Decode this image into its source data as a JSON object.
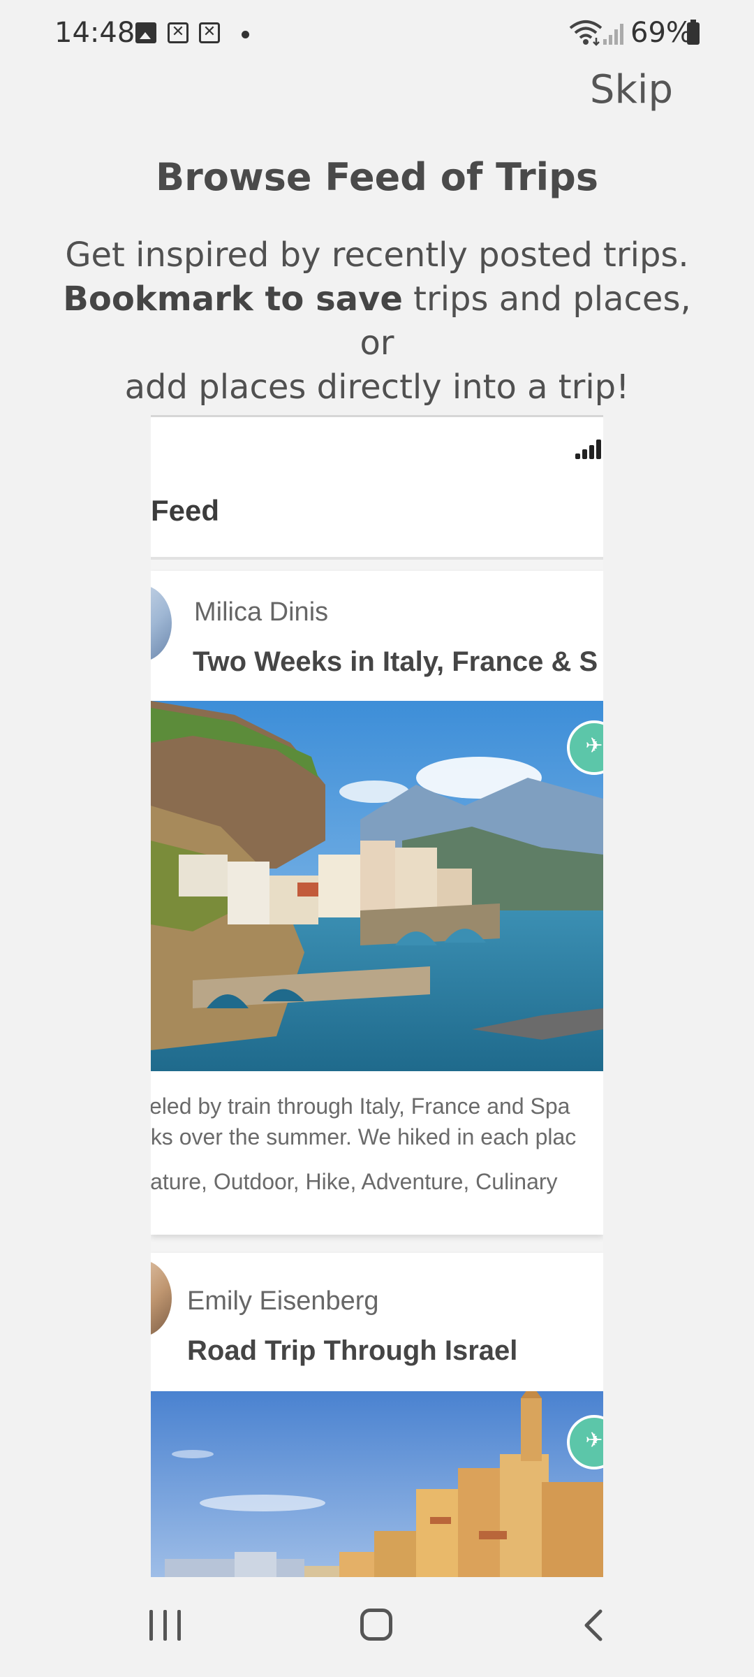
{
  "status_bar": {
    "time": "14:48",
    "battery": "69%",
    "icons": [
      "gallery-icon",
      "xbox-icon",
      "xbox-icon",
      "dot-icon",
      "wifi-icon",
      "signal-icon",
      "battery-icon"
    ]
  },
  "onboarding": {
    "skip_label": "Skip",
    "title": "Browse Feed of Trips",
    "subtitle_line1": "Get inspired by recently posted trips.",
    "subtitle_bold": "Bookmark to save",
    "subtitle_line2_rest": " trips and places, or",
    "subtitle_line3": "add places directly into a trip!"
  },
  "mockup": {
    "header_title": "Feed",
    "posts": [
      {
        "author": "Milica Dinis",
        "title": "Two Weeks in Italy, France & S",
        "description_line1": "veled by train through Italy, France and Spa",
        "description_line2": "eks over the summer. We hiked in each plac",
        "tags": "lature, Outdoor, Hike, Adventure, Culinary"
      },
      {
        "author": "Emily Eisenberg",
        "title": "Road Trip Through Israel"
      }
    ]
  },
  "nav": {
    "icons": [
      "recents-icon",
      "home-icon",
      "back-icon"
    ]
  },
  "colors": {
    "background": "#f2f2f2",
    "accent_badge": "#5cc6a9",
    "text_dark": "#454545"
  }
}
